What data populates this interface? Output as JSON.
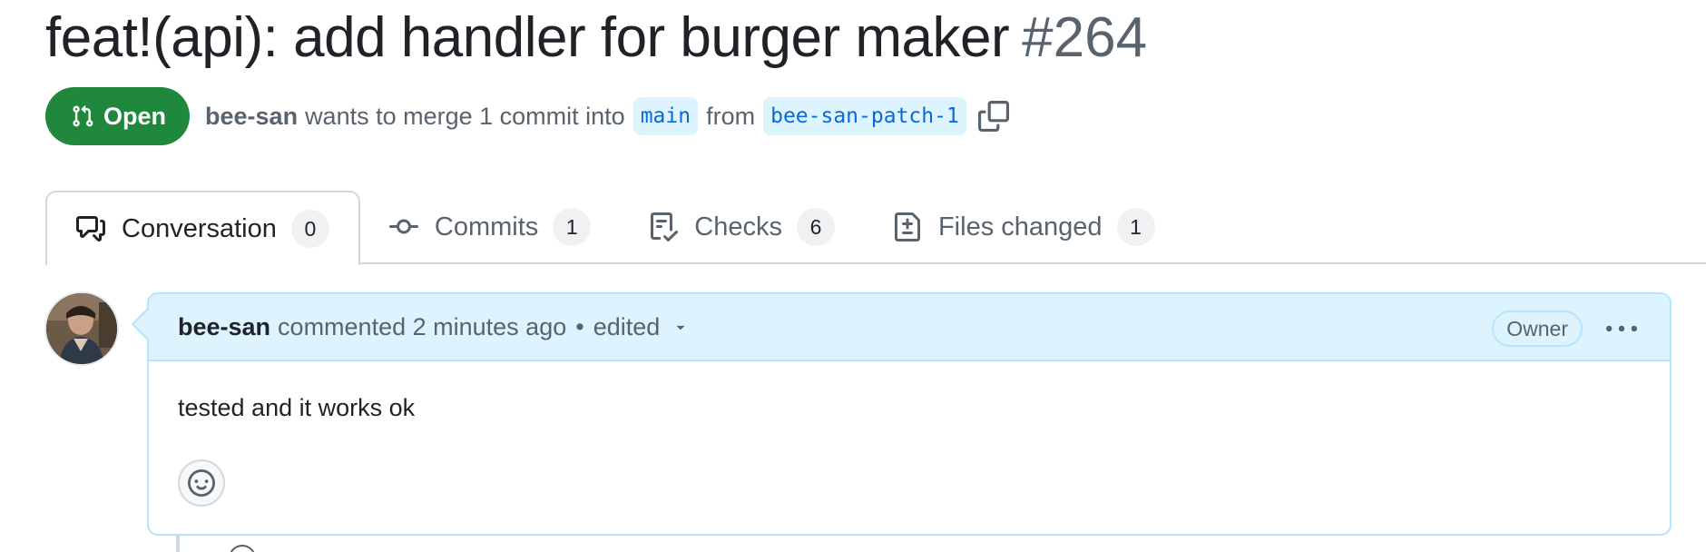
{
  "pr": {
    "title": "feat!(api): add handler for burger maker",
    "number": "#264",
    "state": "Open",
    "author": "bee-san",
    "merge_text": "wants to merge 1 commit into",
    "base_branch": "main",
    "from_text": "from",
    "head_branch": "bee-san-patch-1"
  },
  "tabs": [
    {
      "label": "Conversation",
      "count": "0",
      "icon": "comment-discussion-icon"
    },
    {
      "label": "Commits",
      "count": "1",
      "icon": "git-commit-icon"
    },
    {
      "label": "Checks",
      "count": "6",
      "icon": "checklist-icon"
    },
    {
      "label": "Files changed",
      "count": "1",
      "icon": "file-diff-icon"
    }
  ],
  "comment": {
    "author": "bee-san",
    "action": "commented 2 minutes ago",
    "separator": "•",
    "edited": "edited",
    "role_badge": "Owner",
    "body": "tested and it works ok"
  },
  "colors": {
    "open_green": "#1f883d",
    "link_blue": "#0969da",
    "branch_bg": "#ddf4ff",
    "header_bg": "#ddf4ff",
    "border_blue": "#b6e3ff"
  }
}
